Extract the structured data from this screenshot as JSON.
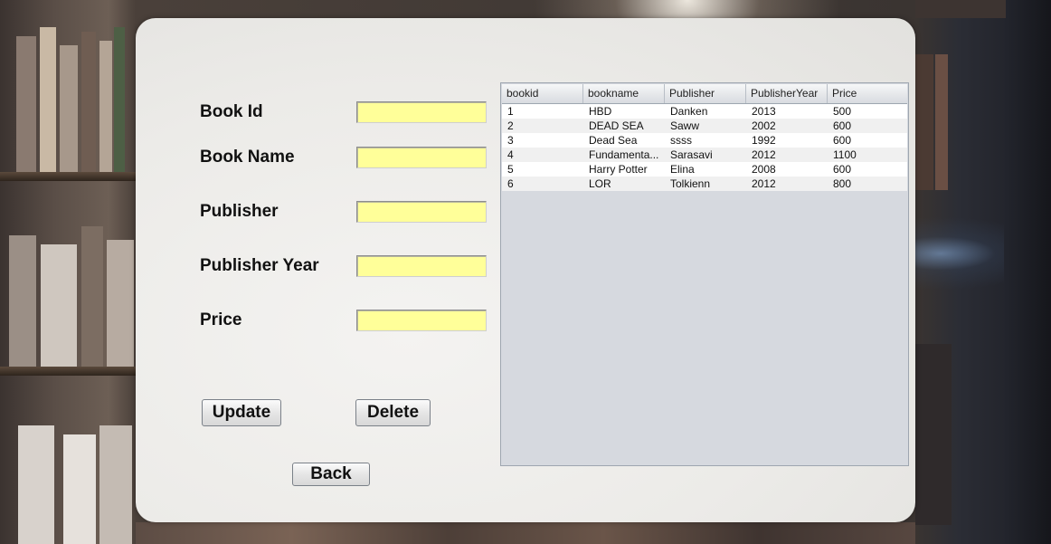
{
  "form": {
    "book_id_label": "Book Id",
    "book_name_label": "Book Name",
    "publisher_label": "Publisher",
    "publisher_year_label": "Publisher Year",
    "price_label": "Price",
    "book_id_value": "",
    "book_name_value": "",
    "publisher_value": "",
    "publisher_year_value": "",
    "price_value": ""
  },
  "buttons": {
    "update": "Update",
    "delete": "Delete",
    "back": "Back"
  },
  "table": {
    "columns": [
      "bookid",
      "bookname",
      "Publisher",
      "PublisherYear",
      "Price"
    ],
    "rows": [
      [
        "1",
        "HBD",
        "Danken",
        "2013",
        "500"
      ],
      [
        "2",
        "DEAD SEA",
        "Saww",
        "2002",
        "600"
      ],
      [
        "3",
        "Dead Sea",
        "ssss",
        "1992",
        "600"
      ],
      [
        "4",
        "Fundamenta...",
        "Sarasavi",
        "2012",
        "1100"
      ],
      [
        "5",
        "Harry Potter",
        "Elina",
        "2008",
        "600"
      ],
      [
        "6",
        "LOR",
        "Tolkienn",
        "2012",
        "800"
      ]
    ]
  },
  "colors": {
    "field_bg": "#ffff99",
    "table_bg": "#d6d9df",
    "panel_bg": "#ecebe8"
  }
}
